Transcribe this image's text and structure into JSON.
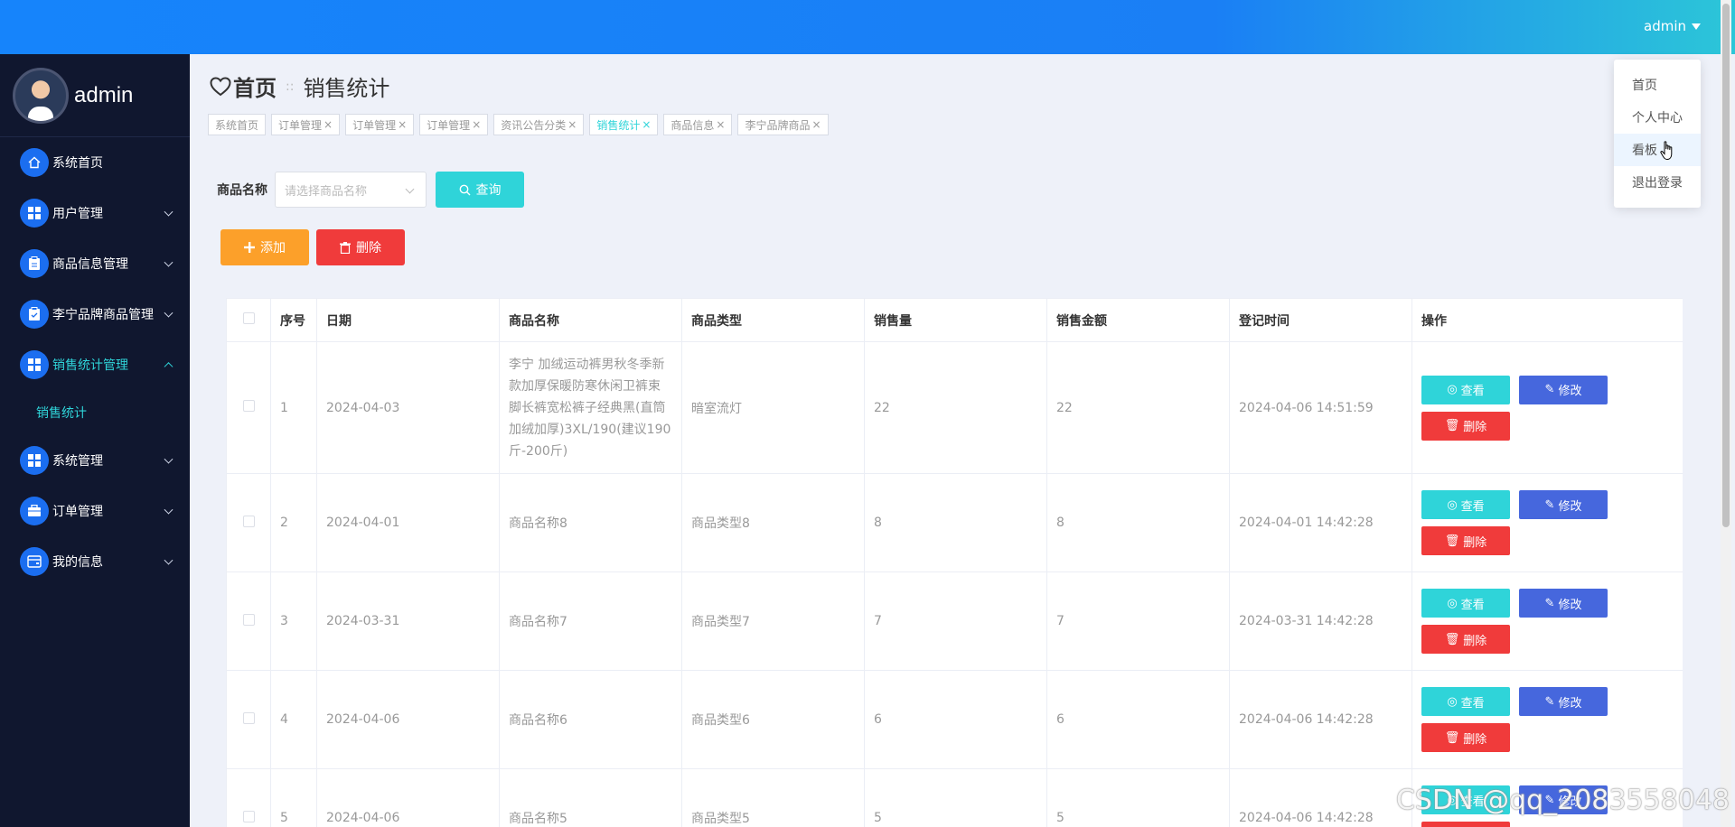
{
  "header": {
    "username": "admin"
  },
  "sidebar": {
    "username": "admin",
    "items": [
      {
        "label": "系统首页",
        "icon": "home-icon",
        "expandable": false
      },
      {
        "label": "用户管理",
        "icon": "grid-icon",
        "expandable": true
      },
      {
        "label": "商品信息管理",
        "icon": "clipboard-icon",
        "expandable": true
      },
      {
        "label": "李宁品牌商品管理",
        "icon": "clipboard-check-icon",
        "expandable": true
      },
      {
        "label": "销售统计管理",
        "icon": "grid-icon",
        "expandable": true,
        "open": true
      },
      {
        "label": "系统管理",
        "icon": "grid-icon",
        "expandable": true
      },
      {
        "label": "订单管理",
        "icon": "briefcase-icon",
        "expandable": true
      },
      {
        "label": "我的信息",
        "icon": "wallet-icon",
        "expandable": true
      }
    ],
    "submenu": {
      "label": "销售统计"
    }
  },
  "breadcrumb": {
    "home": "首页",
    "current": "销售统计"
  },
  "tags": [
    {
      "label": "系统首页",
      "closable": false
    },
    {
      "label": "订单管理",
      "closable": true
    },
    {
      "label": "订单管理",
      "closable": true
    },
    {
      "label": "订单管理",
      "closable": true
    },
    {
      "label": "资讯公告分类",
      "closable": true
    },
    {
      "label": "销售统计",
      "closable": true,
      "active": true
    },
    {
      "label": "商品信息",
      "closable": true
    },
    {
      "label": "李宁品牌商品",
      "closable": true
    }
  ],
  "search": {
    "label": "商品名称",
    "placeholder": "请选择商品名称",
    "query_label": "查询"
  },
  "actions": {
    "add_label": "添加",
    "delete_label": "删除"
  },
  "table": {
    "headers": [
      "序号",
      "日期",
      "商品名称",
      "商品类型",
      "销售量",
      "销售金额",
      "登记时间",
      "操作"
    ],
    "rows": [
      {
        "index": "1",
        "date": "2024-04-03",
        "name": "李宁 加绒运动裤男秋冬季新款加厚保暖防寒休闲卫裤束脚长裤宽松裤子经典黑(直筒加绒加厚)3XL/190(建议190斤-200斤)",
        "type": "暗室流灯",
        "qty": "22",
        "amount": "22",
        "time": "2024-04-06 14:51:59"
      },
      {
        "index": "2",
        "date": "2024-04-01",
        "name": "商品名称8",
        "type": "商品类型8",
        "qty": "8",
        "amount": "8",
        "time": "2024-04-01 14:42:28"
      },
      {
        "index": "3",
        "date": "2024-03-31",
        "name": "商品名称7",
        "type": "商品类型7",
        "qty": "7",
        "amount": "7",
        "time": "2024-03-31 14:42:28"
      },
      {
        "index": "4",
        "date": "2024-04-06",
        "name": "商品名称6",
        "type": "商品类型6",
        "qty": "6",
        "amount": "6",
        "time": "2024-04-06 14:42:28"
      },
      {
        "index": "5",
        "date": "2024-04-06",
        "name": "商品名称5",
        "type": "商品类型5",
        "qty": "5",
        "amount": "5",
        "time": "2024-04-06 14:42:28"
      }
    ],
    "op_labels": {
      "view": "查看",
      "edit": "修改",
      "delete": "删除"
    }
  },
  "dropdown": {
    "items": [
      "首页",
      "个人中心",
      "看板",
      "退出登录"
    ],
    "hovered": "看板"
  },
  "watermark": "CSDN @qq_2083558048"
}
